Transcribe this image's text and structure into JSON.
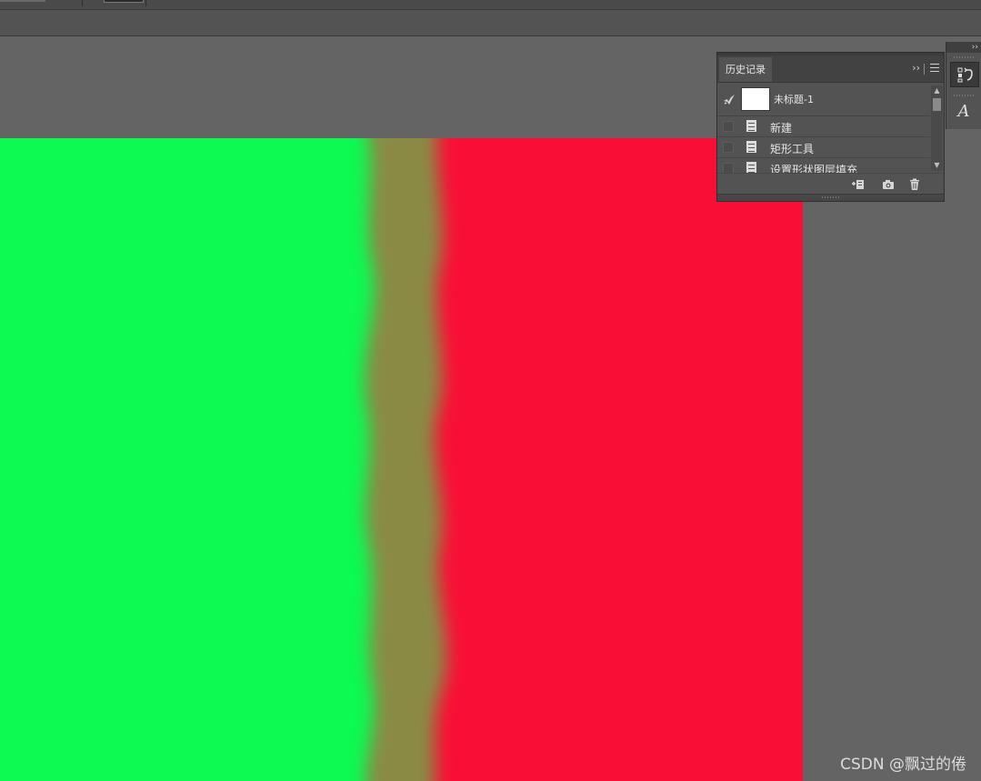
{
  "history_panel": {
    "tab_label": "历史记录",
    "collapse_glyph": "››",
    "snapshot": {
      "label": "未标题-1",
      "thumb_color": "#ffffff"
    },
    "items": [
      {
        "label": "新建",
        "icon": "document-icon"
      },
      {
        "label": "矩形工具",
        "icon": "document-icon"
      },
      {
        "label": "设置形状图层填充",
        "icon": "document-icon"
      }
    ],
    "footer_buttons": [
      "new-document-from-state-icon",
      "camera-icon",
      "trash-icon"
    ]
  },
  "dock": {
    "collapse_glyph": "››",
    "buttons": [
      {
        "name": "history-panel-icon",
        "active": true
      },
      {
        "name": "character-panel-icon",
        "glyph": "A",
        "active": false
      }
    ]
  },
  "canvas": {
    "left_color": "#0cfa52",
    "right_color": "#f90f35",
    "blend_color": "#8a8a45"
  },
  "watermark": "CSDN @飘过的倦"
}
